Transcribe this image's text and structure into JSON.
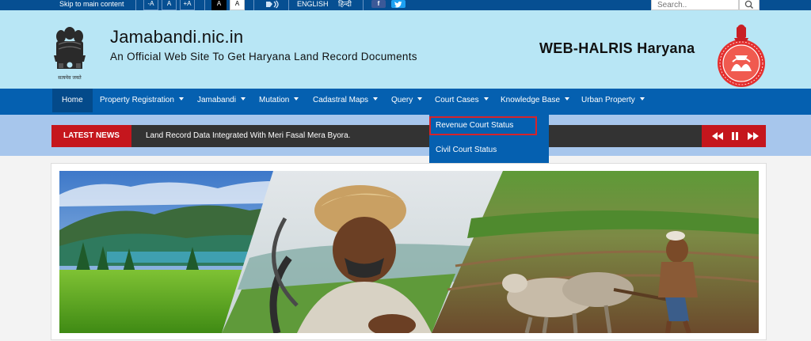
{
  "topbar": {
    "skip_link": "Skip to main content",
    "font_buttons": [
      "-A",
      "A",
      "+A"
    ],
    "contrast_buttons": [
      "A",
      "A"
    ],
    "language_english": "ENGLISH",
    "language_hindi": "हिन्दी",
    "social": [
      "facebook-icon",
      "twitter-icon"
    ],
    "search_placeholder": "Search.."
  },
  "header": {
    "emblem_caption": "सत्यमेव जयते",
    "site_title": "Jamabandi.nic.in",
    "site_subtitle": "An Official Web Site To Get Haryana Land Record Documents",
    "right_title": "WEB-HALRIS Haryana"
  },
  "nav": {
    "items": [
      {
        "label": "Home",
        "has_menu": false,
        "active": true
      },
      {
        "label": "Property Registration",
        "has_menu": true
      },
      {
        "label": "Jamabandi",
        "has_menu": true
      },
      {
        "label": "Mutation",
        "has_menu": true
      },
      {
        "label": "Cadastral Maps",
        "has_menu": true
      },
      {
        "label": "Query",
        "has_menu": true
      },
      {
        "label": "Court Cases",
        "has_menu": true
      },
      {
        "label": "Knowledge Base",
        "has_menu": true
      },
      {
        "label": "Urban Property",
        "has_menu": true
      }
    ]
  },
  "news": {
    "label": "LATEST NEWS",
    "text": "Land Record Data Integrated With Meri Fasal Mera Byora."
  },
  "dropdown": {
    "items": [
      {
        "label": "Revenue Court Status",
        "highlighted": true
      },
      {
        "label": "Civil Court Status",
        "highlighted": false
      }
    ]
  },
  "colors": {
    "topbar": "#064f92",
    "header_bg": "#b8e6f5",
    "nav": "#0560b0",
    "news_red": "#c5161d",
    "highlight": "#d8232a"
  }
}
